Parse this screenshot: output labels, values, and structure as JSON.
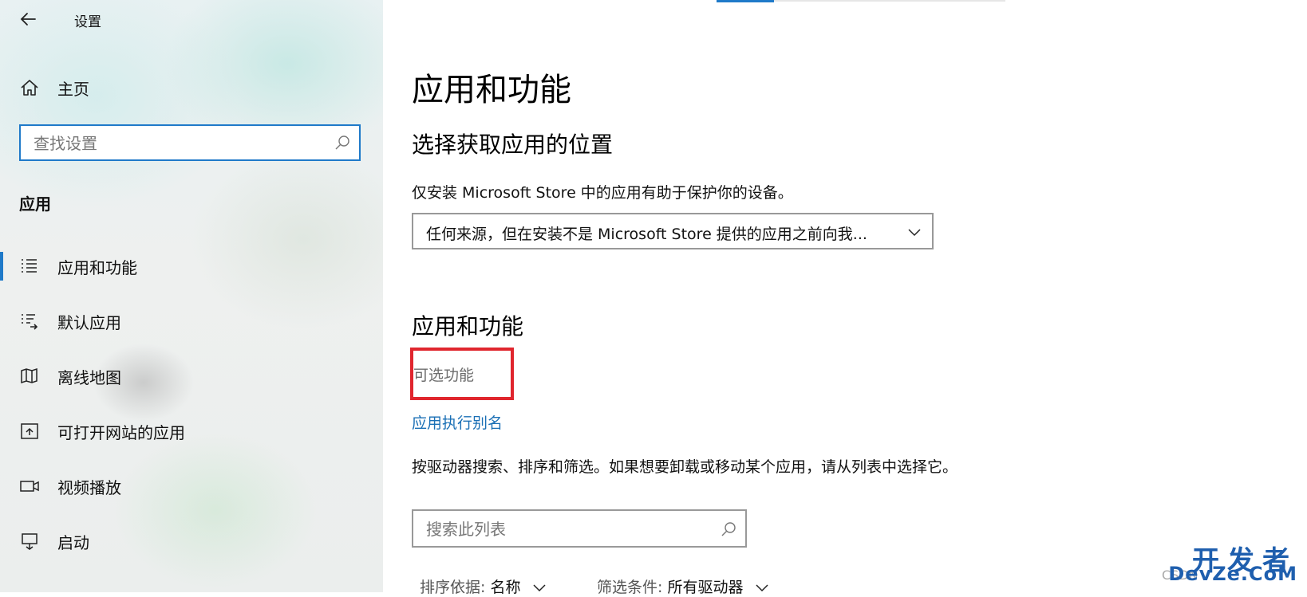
{
  "app_title": "设置",
  "sidebar": {
    "home_label": "主页",
    "search_placeholder": "查找设置",
    "section": "应用",
    "items": [
      {
        "label": "应用和功能",
        "icon": "apps-features-icon",
        "selected": true
      },
      {
        "label": "默认应用",
        "icon": "default-apps-icon"
      },
      {
        "label": "离线地图",
        "icon": "offline-maps-icon"
      },
      {
        "label": "可打开网站的应用",
        "icon": "apps-for-websites-icon"
      },
      {
        "label": "视频播放",
        "icon": "video-playback-icon"
      },
      {
        "label": "启动",
        "icon": "startup-icon"
      }
    ]
  },
  "main": {
    "title": "应用和功能",
    "location_heading": "选择获取应用的位置",
    "location_desc": "仅安装 Microsoft Store 中的应用有助于保护你的设备。",
    "location_dropdown_value": "任何来源，但在安装不是 Microsoft Store 提供的应用之前向我...",
    "apps_heading": "应用和功能",
    "optional_features": "可选功能",
    "alias_link": "应用执行别名",
    "list_desc": "按驱动器搜索、排序和筛选。如果想要卸载或移动某个应用，请从列表中选择它。",
    "list_search_placeholder": "搜索此列表",
    "sort_key": "排序依据:",
    "sort_value": "名称",
    "filter_key": "筛选条件:",
    "filter_value": "所有驱动器"
  },
  "watermark": {
    "line1": "开发者",
    "line2": "DevZe.CoM",
    "csdn": "CSDN"
  },
  "colors": {
    "accent": "#1f7ac9",
    "highlight_box": "#e0262e",
    "link": "#1a6fb5"
  }
}
